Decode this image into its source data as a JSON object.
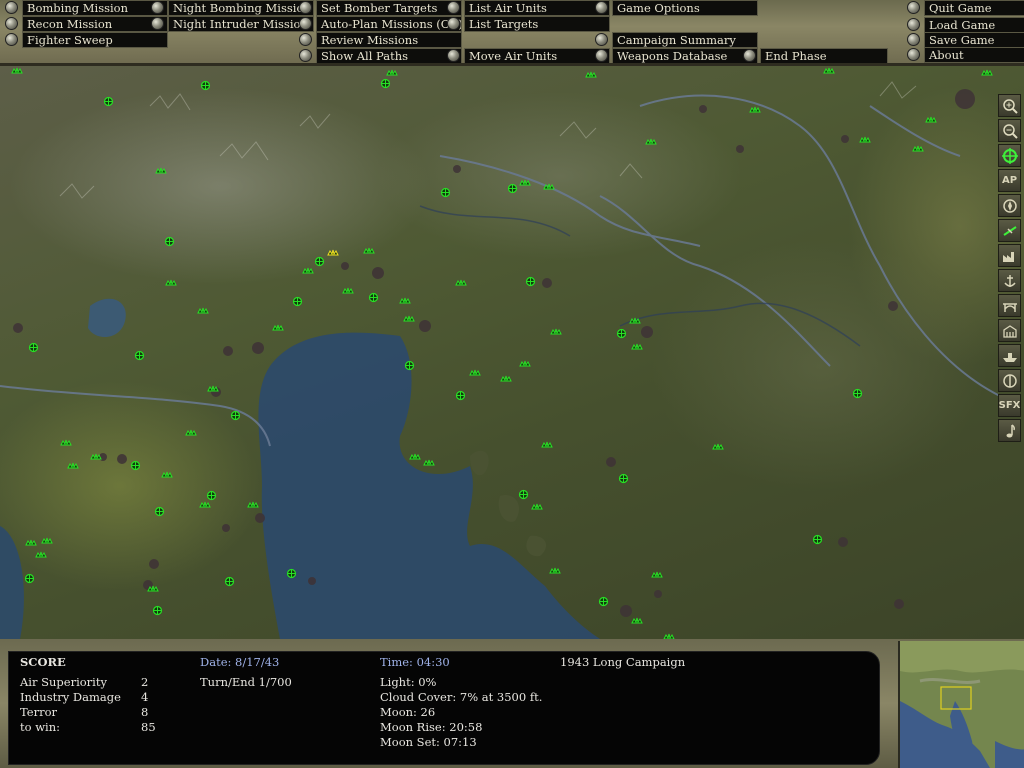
{
  "menu": {
    "col1": [
      "Bombing Mission",
      "Recon Mission",
      "Fighter Sweep"
    ],
    "col2": [
      "Night Bombing Mission",
      "Night Intruder Mission"
    ],
    "col3": [
      "Set Bomber Targets",
      "Auto-Plan Missions (Off)",
      "Review Missions",
      "Show All Paths"
    ],
    "col4": [
      "List Air Units",
      "List Targets",
      "Move Air Units"
    ],
    "col5": [
      "Game Options",
      "Campaign Summary",
      "Weapons Database"
    ],
    "end_phase": "End Phase",
    "col6": [
      "Quit Game",
      "Load Game",
      "Save Game",
      "About"
    ]
  },
  "toolbar": {
    "items": [
      "zoom-in",
      "zoom-out",
      "target",
      "AP",
      "compass",
      "airfield",
      "factory",
      "anchor",
      "bridge",
      "city",
      "ship",
      "flak",
      "SFX",
      "music"
    ],
    "ap_label": "AP",
    "sfx_label": "SFX"
  },
  "score": {
    "title": "SCORE",
    "rows": [
      {
        "label": "Air Superiority",
        "value": "2"
      },
      {
        "label": "Industry Damage",
        "value": "4"
      },
      {
        "label": "Terror",
        "value": "8"
      },
      {
        "label": "to win:",
        "value": "85"
      }
    ],
    "date": "Date: 8/17/43",
    "turn": "Turn/End 1/700",
    "time": "Time: 04:30",
    "campaign": "1943 Long Campaign",
    "light": "Light: 0%",
    "cloud": "Cloud Cover: 7% at 3500 ft.",
    "moon": "Moon: 26",
    "moon_rise": "Moon Rise: 20:58",
    "moon_set": "Moon Set: 07:13"
  },
  "colors": {
    "unit_green": "#27e024",
    "unit_selected": "#f0e020",
    "sea": "#2c4a6a",
    "minimap_frame": "#e0d020"
  }
}
